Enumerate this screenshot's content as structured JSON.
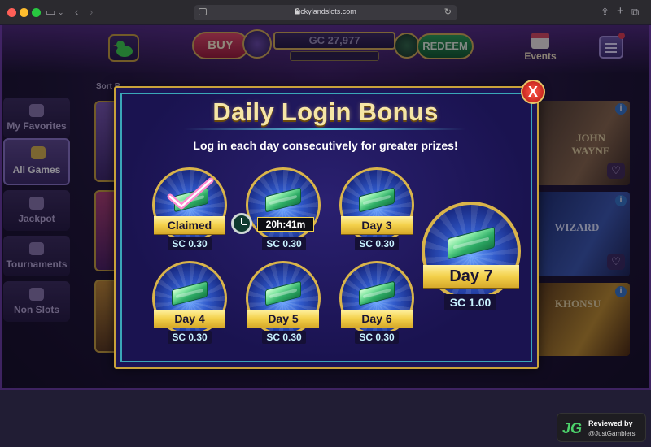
{
  "browser": {
    "url": "luckylandslots.com"
  },
  "topbar": {
    "buy_label": "BUY",
    "gc_balance": "GC 27,977",
    "redeem_label": "REDEEM",
    "events_label": "Events"
  },
  "sidebar": {
    "sort_label": "Sort B",
    "items": [
      {
        "label": "My Favorites"
      },
      {
        "label": "All Games"
      },
      {
        "label": "Jackpot"
      },
      {
        "label": "Tournaments"
      },
      {
        "label": "Non Slots"
      }
    ]
  },
  "tiles": [
    {
      "label": "JOHN WAYNE"
    },
    {
      "label": "WIZARD"
    },
    {
      "label": "KHONSU"
    }
  ],
  "modal": {
    "title": "Daily Login Bonus",
    "subtitle": "Log in each day consecutively for greater prizes!",
    "close_label": "X",
    "days": [
      {
        "label": "Claimed",
        "prize": "SC 0.30",
        "status": "claimed"
      },
      {
        "label": "20h:41m",
        "prize": "SC 0.30",
        "status": "countdown"
      },
      {
        "label": "Day 3",
        "prize": "SC 0.30",
        "status": "locked"
      },
      {
        "label": "Day 4",
        "prize": "SC 0.30",
        "status": "locked"
      },
      {
        "label": "Day 5",
        "prize": "SC 0.30",
        "status": "locked"
      },
      {
        "label": "Day 6",
        "prize": "SC 0.30",
        "status": "locked"
      },
      {
        "label": "Day 7",
        "prize": "SC 1.00",
        "status": "locked"
      }
    ]
  },
  "badge": {
    "logo": "JG",
    "line1": "Reviewed by",
    "line2": "@JustGamblers"
  },
  "colors": {
    "gold": "#d9b44a",
    "modal_bg": "#1d1557",
    "teal_border": "#3aa7b8",
    "ribbon_yellow": "#f3d04a",
    "close_red": "#e0231a"
  }
}
